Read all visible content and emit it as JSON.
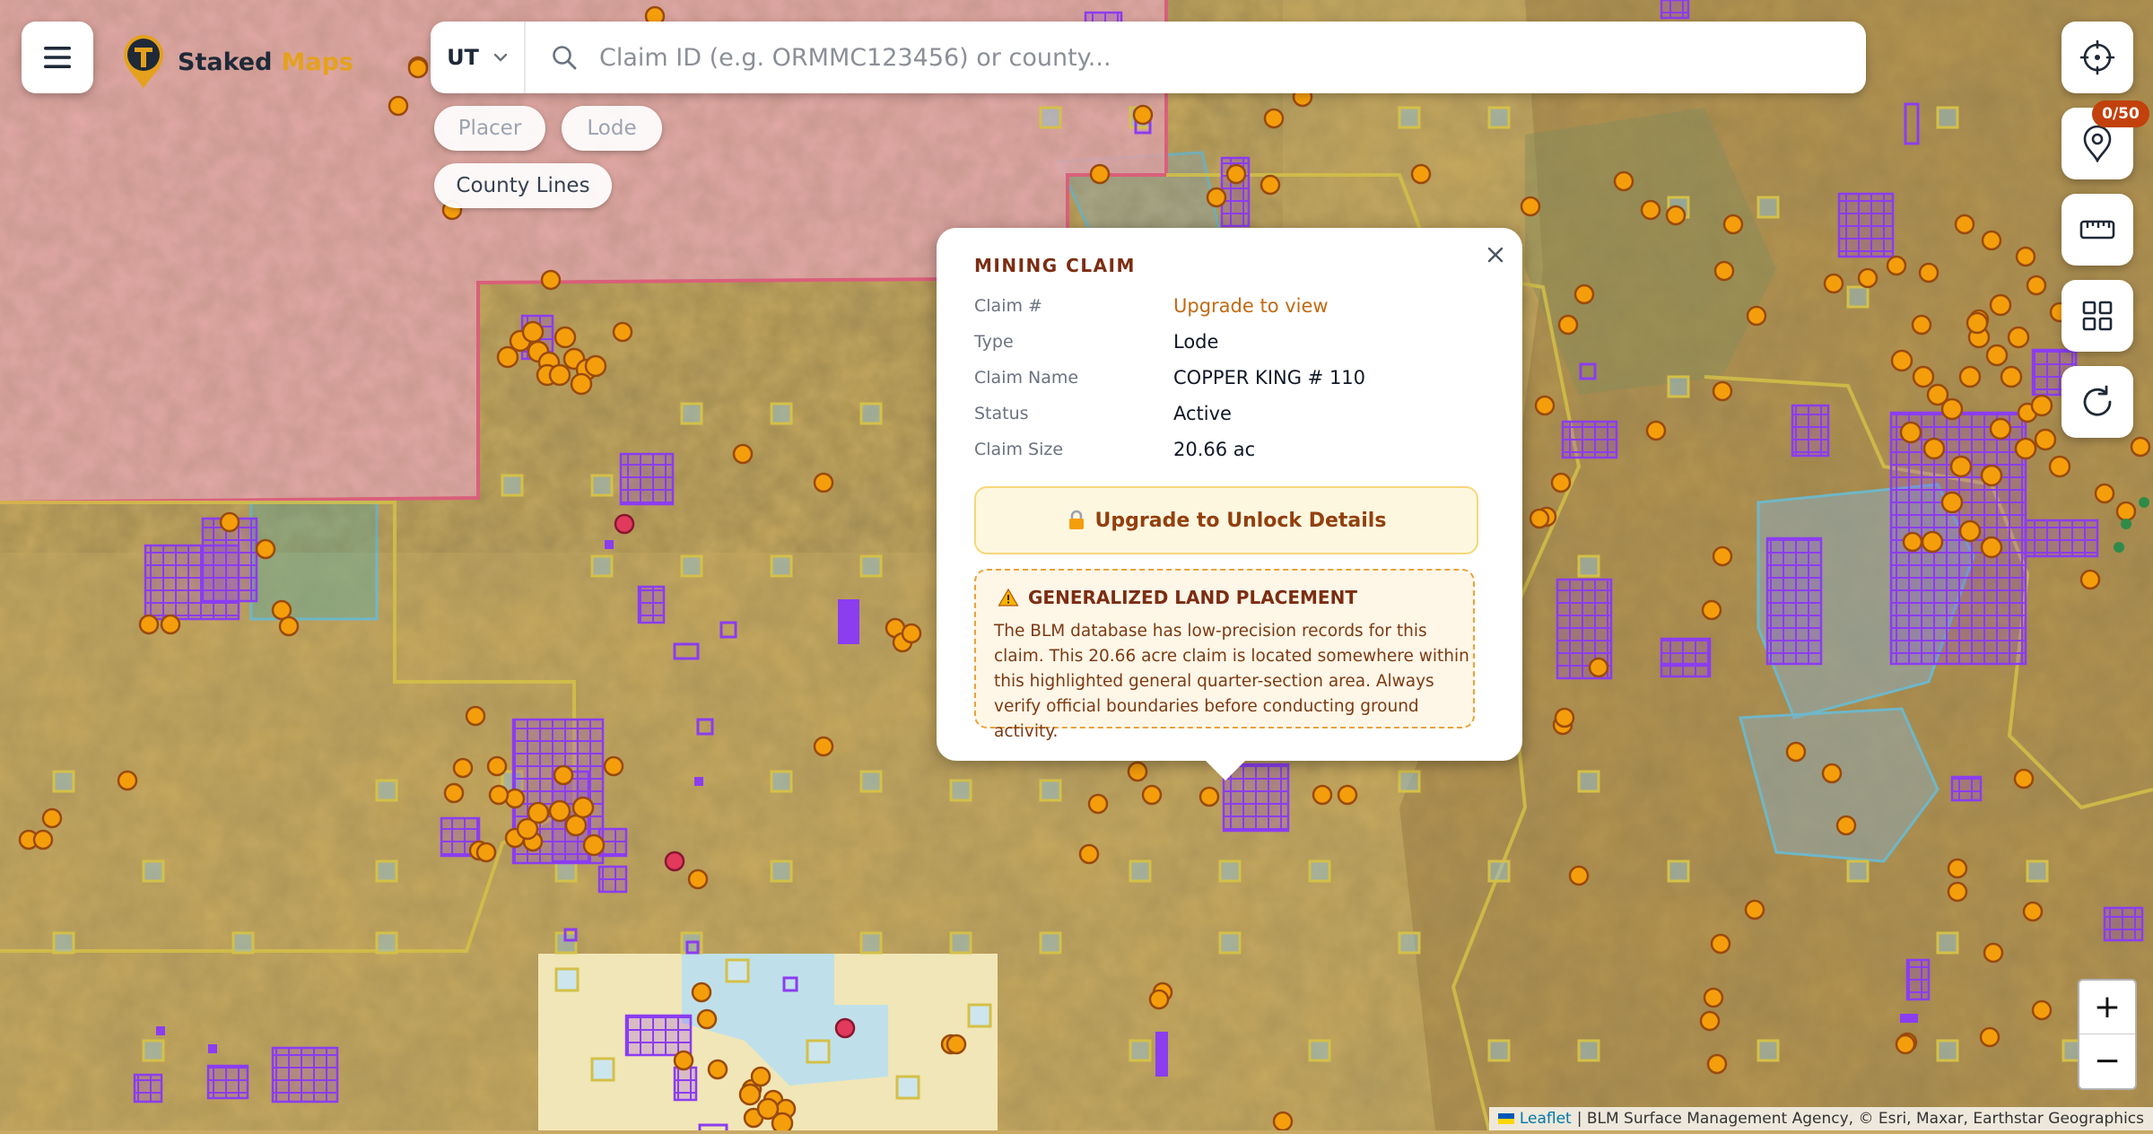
{
  "app": {
    "logo_word1": "Staked",
    "logo_word2": "Maps"
  },
  "search": {
    "state_value": "UT",
    "placeholder": "Claim ID (e.g. ORMMC123456) or county..."
  },
  "filters": {
    "placer": "Placer",
    "lode": "Lode",
    "county_lines": "County Lines"
  },
  "popup": {
    "title": "MINING CLAIM",
    "rows": [
      {
        "label": "Claim #",
        "value": "Upgrade to view"
      },
      {
        "label": "Type",
        "value": "Lode"
      },
      {
        "label": "Claim Name",
        "value": "COPPER KING # 110"
      },
      {
        "label": "Status",
        "value": "Active"
      },
      {
        "label": "Claim Size",
        "value": "20.66 ac"
      }
    ],
    "unlock_button": "Upgrade to Unlock Details",
    "warning_title": "GENERALIZED LAND PLACEMENT",
    "warning_text": "The BLM database has low-precision records for this claim. This 20.66 acre claim is located somewhere within this highlighted general quarter-section area. Always verify official boundaries before conducting ground activity."
  },
  "controls": {
    "saved_badge": "0/50",
    "icons": [
      "crosshair-icon",
      "map-pin-icon",
      "ruler-icon",
      "grid-icon",
      "refresh-icon"
    ]
  },
  "zoom": {
    "in_label": "+",
    "out_label": "−"
  },
  "attribution": {
    "leaflet": "Leaflet",
    "sources": "| BLM Surface Management Agency, © Esri, Maxar, Earthstar Geographics"
  },
  "colors": {
    "blm_land": "#d9b757",
    "forest_service": "#e6a6b7",
    "claim_marker": "#f59e0b",
    "claim_grid": "#8b3df0",
    "accent": "#e5a11d"
  }
}
